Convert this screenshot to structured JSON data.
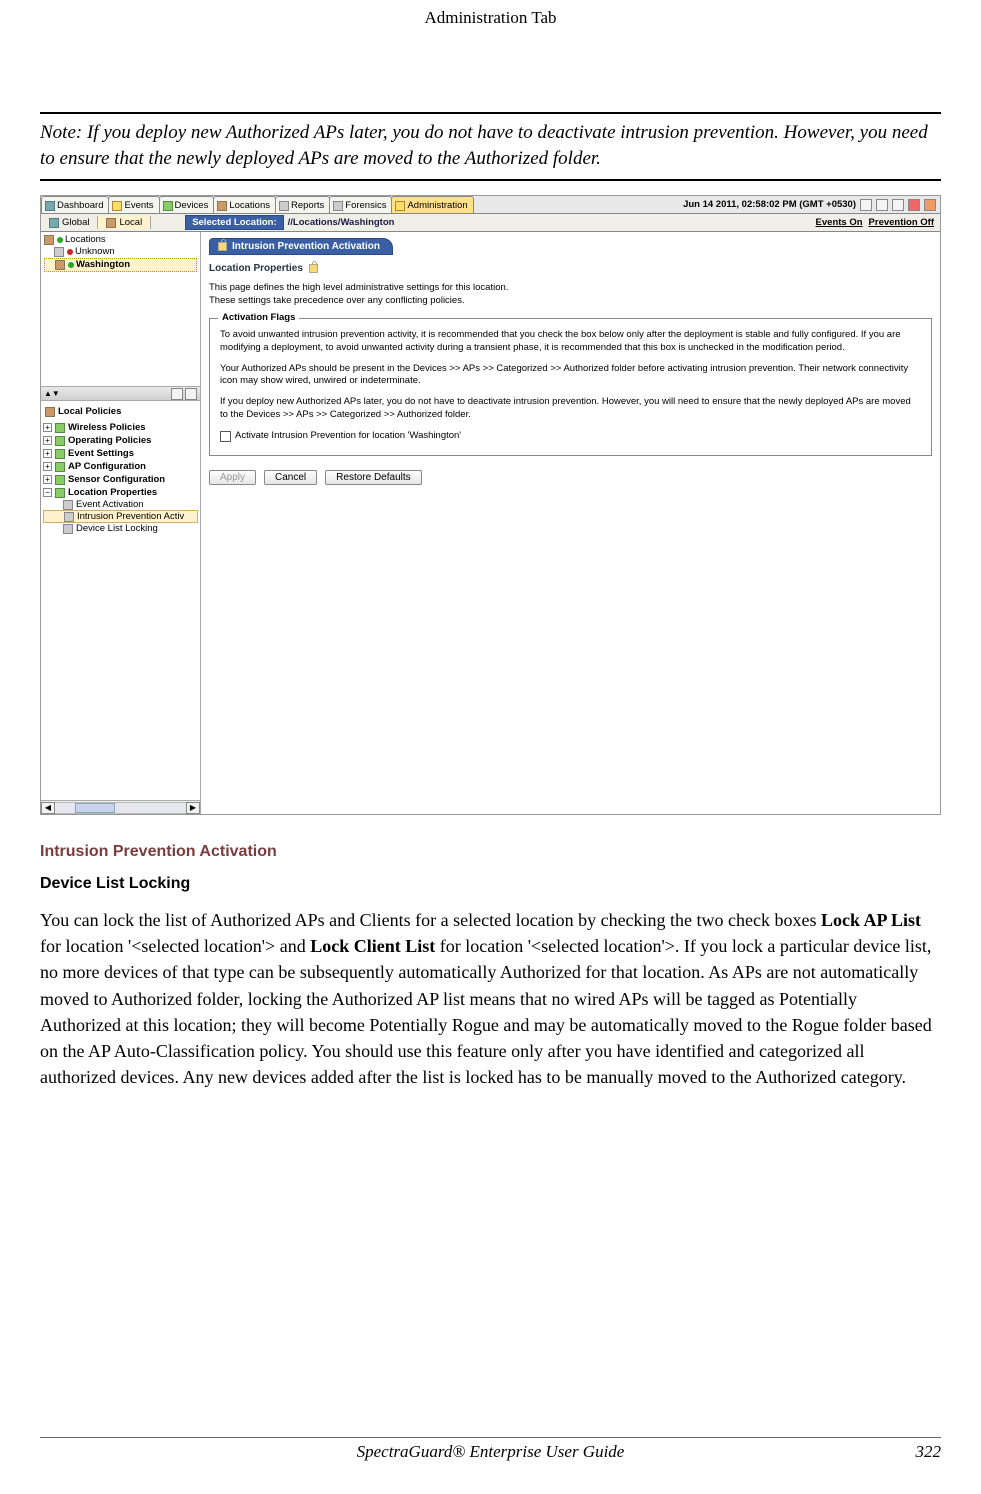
{
  "page": {
    "header": "Administration Tab",
    "note": "Note: If you deploy new Authorized APs later, you do not have to deactivate intrusion prevention. However, you need to ensure that the newly deployed APs are moved to the Authorized  folder."
  },
  "screenshot": {
    "tabs": {
      "dashboard": "Dashboard",
      "events": "Events",
      "devices": "Devices",
      "locations": "Locations",
      "reports": "Reports",
      "forensics": "Forensics",
      "administration": "Administration"
    },
    "datetime": "Jun 14 2011, 02:58:02 PM (GMT +0530)",
    "subtabs": {
      "global": "Global",
      "local": "Local"
    },
    "selected_location_label": "Selected Location:",
    "selected_location_path": "//Locations/Washington",
    "events_link": "Events On",
    "prevention_link": "Prevention Off",
    "tree": {
      "root": "Locations",
      "unknown": "Unknown",
      "washington": "Washington"
    },
    "split_label": "▲▼",
    "local_policies": "Local Policies",
    "policies": {
      "wireless": "Wireless Policies",
      "operating": "Operating Policies",
      "event": "Event Settings",
      "ap": "AP Configuration",
      "sensor": "Sensor Configuration",
      "location": "Location Properties"
    },
    "lp_children": {
      "event_activation": "Event Activation",
      "intrusion_prevention": "Intrusion Prevention Activ",
      "device_list_locking": "Device List Locking"
    },
    "main": {
      "crumb": "Intrusion Prevention Activation",
      "section_title": "Location Properties",
      "desc1": "This page defines the high level administrative settings for this location.",
      "desc2": "These settings take precedence over any conflicting policies.",
      "legend": "Activation Flags",
      "p1": "To avoid unwanted intrusion prevention activity, it is recommended that you check the box below only after the deployment is stable and fully configured. If you are modifying a deployment, to avoid unwanted activity during a transient phase, it is recommended that this box is unchecked in the modification period.",
      "p2": "Your Authorized APs should be present in the Devices >> APs >> Categorized >> Authorized folder before activating intrusion prevention. Their network connectivity icon may show wired, unwired or indeterminate.",
      "p3": "If you deploy new Authorized APs later, you do not have to deactivate intrusion prevention. However, you will need to ensure that the newly deployed APs are moved to the Devices >> APs >> Categorized >> Authorized folder.",
      "checkbox_label": "Activate Intrusion Prevention for location  'Washington'",
      "btn_apply": "Apply",
      "btn_cancel": "Cancel",
      "btn_restore": "Restore Defaults"
    }
  },
  "after": {
    "caption": "Intrusion Prevention Activation",
    "subheading": "Device List Locking",
    "body_parts": {
      "t1": "You can lock the list of Authorized APs and Clients for a selected location by checking the two check boxes ",
      "b1": "Lock AP List",
      "t2": " for location '<selected location'> and ",
      "b2": "Lock Client List",
      "t3": " for location '<selected location'>. If you lock a particular device list, no more devices of that type can be subsequently automatically Authorized for that location. As APs are not automatically moved to Authorized folder, locking the Authorized AP list means that no wired APs will be tagged as Potentially Authorized at this location; they will become Potentially Rogue and may be automatically moved to the Rogue folder based on the AP Auto-Classification policy. You should use this feature only after you have identified and categorized all authorized devices. Any new devices added after the list is locked has to be manually moved to the Authorized category."
    }
  },
  "footer": {
    "center": "SpectraGuard®  Enterprise User Guide",
    "right": "322"
  }
}
